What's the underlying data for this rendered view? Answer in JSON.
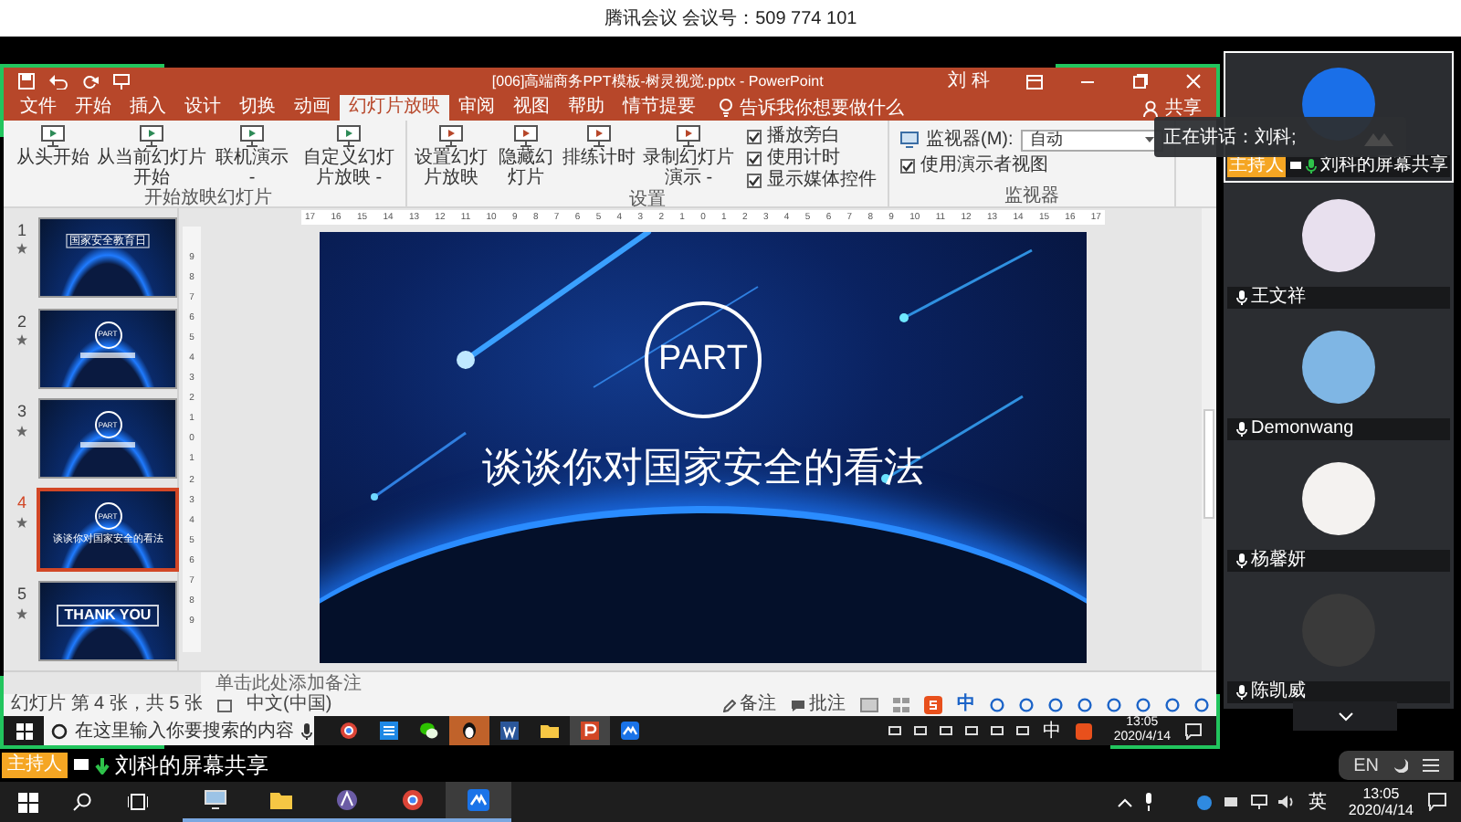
{
  "meeting_header": {
    "title": "腾讯会议 会议号：509 774 101"
  },
  "powerpoint": {
    "title": "[006]高端商务PPT模板-树灵视觉.pptx - PowerPoint",
    "user": "刘 科",
    "tabs": [
      {
        "label": "文件",
        "selected": false
      },
      {
        "label": "开始",
        "selected": false
      },
      {
        "label": "插入",
        "selected": false
      },
      {
        "label": "设计",
        "selected": false
      },
      {
        "label": "切换",
        "selected": false
      },
      {
        "label": "动画",
        "selected": false
      },
      {
        "label": "幻灯片放映",
        "selected": true
      },
      {
        "label": "审阅",
        "selected": false
      },
      {
        "label": "视图",
        "selected": false
      },
      {
        "label": "帮助",
        "selected": false
      },
      {
        "label": "情节提要",
        "selected": false
      }
    ],
    "tell_me": "告诉我你想要做什么",
    "share": "共享",
    "ribbon_groups": [
      {
        "label": "开始放映幻灯片",
        "items": [
          {
            "kind": "button",
            "label": "从头开始"
          },
          {
            "kind": "button",
            "label": "从当前幻灯片开始"
          },
          {
            "kind": "button",
            "label": "联机演示 -"
          },
          {
            "kind": "button",
            "label": "自定义幻灯片放映 -"
          }
        ]
      },
      {
        "label": "设置",
        "items": [
          {
            "kind": "button",
            "label": "设置幻灯片放映"
          },
          {
            "kind": "button",
            "label": "隐藏幻灯片"
          },
          {
            "kind": "button",
            "label": "排练计时"
          },
          {
            "kind": "button",
            "label": "录制幻灯片演示 -"
          },
          {
            "kind": "checkbox",
            "label": "播放旁白",
            "checked": true
          },
          {
            "kind": "checkbox",
            "label": "使用计时",
            "checked": true
          },
          {
            "kind": "checkbox",
            "label": "显示媒体控件",
            "checked": true
          }
        ]
      },
      {
        "label": "监视器",
        "items": [
          {
            "kind": "dropdown",
            "label": "监视器(M):",
            "value": "自动"
          },
          {
            "kind": "checkbox",
            "label": "使用演示者视图",
            "checked": true
          }
        ]
      }
    ],
    "ruler": [
      "17",
      "16",
      "15",
      "14",
      "13",
      "12",
      "11",
      "10",
      "9",
      "8",
      "7",
      "6",
      "5",
      "4",
      "3",
      "2",
      "1",
      "0",
      "1",
      "2",
      "3",
      "4",
      "5",
      "6",
      "7",
      "8",
      "9",
      "10",
      "11",
      "12",
      "13",
      "14",
      "15",
      "16",
      "17"
    ],
    "vertical_ruler": [
      "9",
      "8",
      "7",
      "6",
      "5",
      "4",
      "3",
      "2",
      "1",
      "0",
      "1",
      "2",
      "3",
      "4",
      "5",
      "6",
      "7",
      "8",
      "9"
    ],
    "thumbnails": [
      {
        "number": "1",
        "kind": "cover",
        "title": "国家安全教育日",
        "selected": false
      },
      {
        "number": "2",
        "kind": "part",
        "badge": "PART",
        "selected": false
      },
      {
        "number": "3",
        "kind": "part",
        "badge": "PART",
        "selected": false
      },
      {
        "number": "4",
        "kind": "part",
        "badge": "PART",
        "title": "谈谈你对国家安全的看法",
        "selected": true
      },
      {
        "number": "5",
        "kind": "closing",
        "title": "THANK YOU",
        "selected": false
      }
    ],
    "slide": {
      "badge": "PART",
      "title": "谈谈你对国家安全的看法"
    },
    "notes_placeholder": "单击此处添加备注",
    "status_bar": {
      "slide_info": "幻灯片 第 4 张，共 5 张",
      "language": "中文(中国)",
      "notes": "备注",
      "comments": "批注",
      "ime_mode": "中"
    }
  },
  "shared_taskbar": {
    "search_placeholder": "在这里输入你要搜索的内容",
    "ime": "中",
    "time": "13:05",
    "date": "2020/4/14"
  },
  "share_label": {
    "badge": "主持人",
    "text": "刘科的屏幕共享"
  },
  "speaking_tooltip": "正在讲话：刘科;",
  "participants": [
    {
      "name": "刘科的屏幕共享",
      "host_badge": "主持人",
      "selected": true,
      "speaking": true,
      "color": "#1a6fe8"
    },
    {
      "name": "王文祥",
      "selected": false,
      "speaking": false,
      "color": "#e8e0ee"
    },
    {
      "name": "Demonwang",
      "selected": false,
      "speaking": false,
      "color": "#7fb6e4"
    },
    {
      "name": "杨馨妍",
      "selected": false,
      "speaking": false,
      "color": "#f4f2f0"
    },
    {
      "name": "陈凯威",
      "selected": false,
      "speaking": false,
      "color": "#3a3a3a"
    }
  ],
  "ime_pill": {
    "language": "EN"
  },
  "taskbar": {
    "ime": "英",
    "time": "13:05",
    "date": "2020/4/14"
  }
}
